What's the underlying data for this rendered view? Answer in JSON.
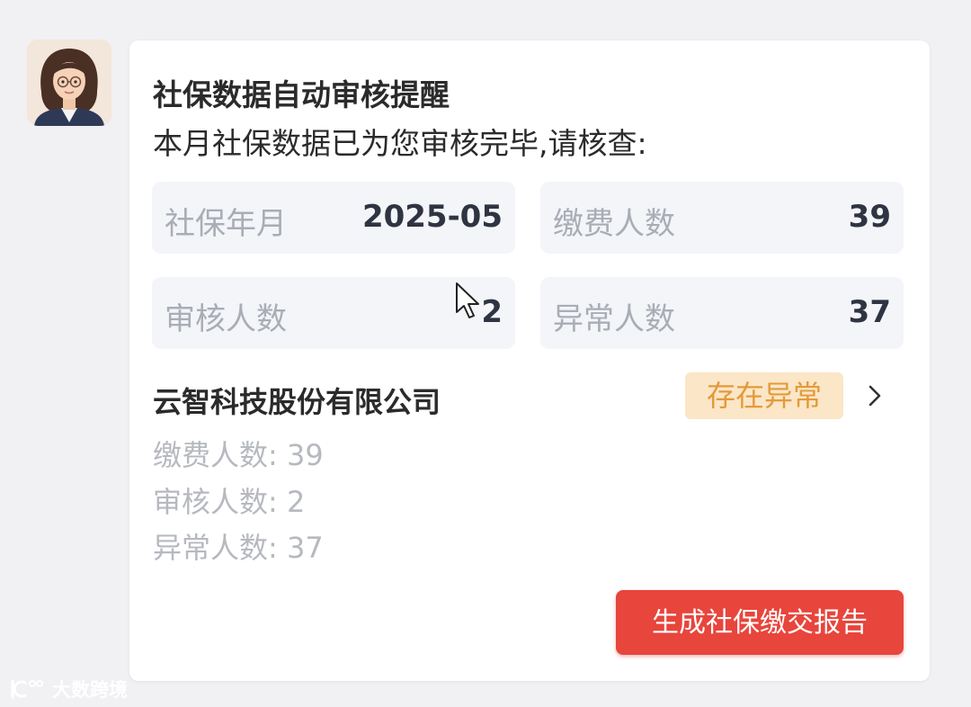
{
  "notification": {
    "title": "社保数据自动审核提醒",
    "subtitle": "本月社保数据已为您审核完毕,请核查:"
  },
  "stats": [
    {
      "label": "社保年月",
      "value": "2025-05"
    },
    {
      "label": "缴费人数",
      "value": "39"
    },
    {
      "label": "审核人数",
      "value": "2"
    },
    {
      "label": "异常人数",
      "value": "37"
    }
  ],
  "company": {
    "name": "云智科技股份有限公司",
    "status_badge": "存在异常",
    "details": [
      "缴费人数:  39",
      "审核人数:  2",
      "异常人数:  37"
    ]
  },
  "actions": {
    "generate_report": "生成社保缴交报告"
  },
  "watermark": {
    "text": "大数跨境"
  },
  "icons": {
    "avatar": "assistant-avatar",
    "chevron": "chevron-right-icon",
    "cursor": "mouse-cursor-icon",
    "watermark_logo": "watermark-logo-icon"
  },
  "colors": {
    "accent_red": "#e8453c",
    "badge_bg": "#fbe6c7",
    "badge_text": "#e49a3a",
    "stat_bg": "#f3f5f9"
  }
}
